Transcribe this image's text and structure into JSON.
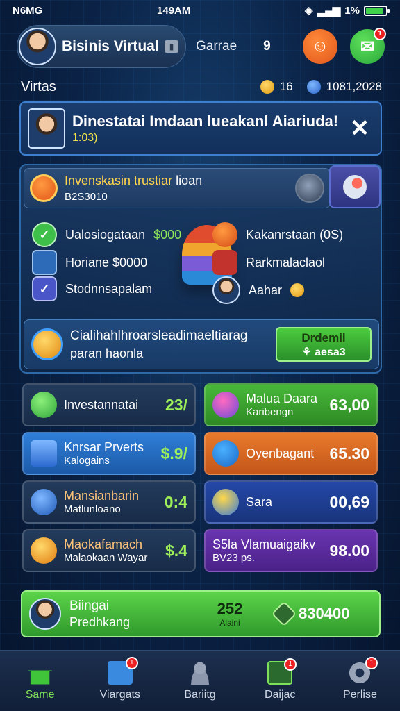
{
  "status_bar": {
    "carrier": "N6MG",
    "time": "149AM",
    "battery_text": "1%"
  },
  "header": {
    "profile_name": "Bisinis Virtual",
    "label": "Garrae",
    "glyph": "9",
    "orange_btn_icon": "profile-icon",
    "green_btn_icon": "envelope-check-icon",
    "green_btn_badge": "1"
  },
  "section": {
    "title": "Virtas",
    "stat1": "16",
    "stat2": "1081,2028"
  },
  "banner": {
    "title": "Dinestatai Imdaan lueakanl Aiariuda!",
    "subtitle": "1:03)",
    "close": "✕"
  },
  "panel": {
    "top_title": "Invenskasin trustiar",
    "top_title_extra": "lioan",
    "top_sub": "B2S3010",
    "features_left": [
      {
        "label": "Ualosiogataan",
        "value": "$000",
        "icon": "check-icon"
      },
      {
        "label": "Horiane $0000",
        "value": "",
        "icon": "chart-tile-icon"
      },
      {
        "label": "Stodnnsapalam",
        "value": "",
        "icon": "check-icon"
      }
    ],
    "features_right": [
      {
        "label": "Kakanrstaan (0S)",
        "icon": "orange-coin-icon"
      },
      {
        "label": "Rarkmalaclaol",
        "icon": "red-box-icon"
      },
      {
        "label": "Aahar",
        "icon": "avatar-icon"
      }
    ],
    "challenge": {
      "title": "Cialihahlhroarsleadimaeltiarag",
      "sub": "paran haonla",
      "btn_label": "Drdemil",
      "btn_value": "⚘ aesa3"
    }
  },
  "cards": [
    {
      "title": "Investannatai",
      "sub": "",
      "value": "23/",
      "style": "dark",
      "icon": "growth-icon"
    },
    {
      "title": "Malua Daara",
      "sub": "Karibengn",
      "value": "63,00",
      "style": "green",
      "icon": "people-icon"
    },
    {
      "title": "Knrsar Prverts",
      "sub": "Kalogains",
      "value": "$.9/",
      "style": "blue",
      "icon": "document-icon"
    },
    {
      "title": "Oyenbagant",
      "sub": "",
      "value": "65.30",
      "style": "orange",
      "icon": "chart-icon"
    },
    {
      "title": "Mansianbarin",
      "sub": "Matlunloano",
      "value": "0:4",
      "style": "dark",
      "icon": "arrow-icon"
    },
    {
      "title": "Sara",
      "sub": "",
      "value": "00,69",
      "style": "navy",
      "icon": "star-icon"
    },
    {
      "title": "Maokafamach",
      "sub": "Malaokaan Wayar",
      "value": "$.4",
      "style": "dark",
      "icon": "coins-icon"
    },
    {
      "title": "S5la Vlamuaigaikv",
      "sub": "BV23 ps.",
      "value": "98.00",
      "style": "purple",
      "icon": "none"
    }
  ],
  "bottom_bar": {
    "title": "Biingai",
    "sub": "Predhkang",
    "center_value": "252",
    "center_sub": "Alaini",
    "right_value": "830400"
  },
  "nav": [
    {
      "label": "Same",
      "icon": "home-icon",
      "badge": "",
      "active": true
    },
    {
      "label": "Viargats",
      "icon": "mail-icon",
      "badge": "1",
      "active": false
    },
    {
      "label": "Bariitg",
      "icon": "group-icon",
      "badge": "",
      "active": false
    },
    {
      "label": "Daijac",
      "icon": "task-icon",
      "badge": "1",
      "active": false
    },
    {
      "label": "Perlise",
      "icon": "gear-icon",
      "badge": "1",
      "active": false
    }
  ]
}
